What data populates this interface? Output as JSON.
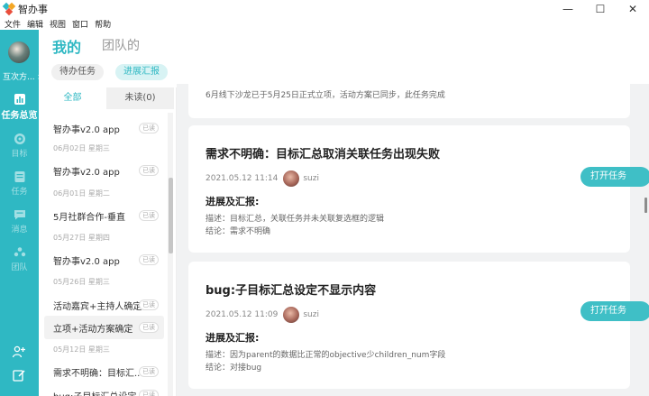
{
  "window": {
    "title": "智办事"
  },
  "window_controls": {
    "minimize": "—",
    "maximize": "☐",
    "close": "✕"
  },
  "menu": [
    "文件",
    "编辑",
    "视图",
    "窗口",
    "帮助"
  ],
  "rail": {
    "user_name": "互次方... >",
    "items": [
      {
        "label": "任务总览",
        "icon": "chart-icon",
        "active": true
      },
      {
        "label": "目标",
        "icon": "target-icon",
        "active": false
      },
      {
        "label": "任务",
        "icon": "task-icon",
        "active": false
      },
      {
        "label": "消息",
        "icon": "message-icon",
        "active": false
      },
      {
        "label": "团队",
        "icon": "team-icon",
        "active": false
      }
    ]
  },
  "top_tabs": {
    "mine": "我的",
    "team": "团队的"
  },
  "sub_tabs": {
    "todo": "待办任务",
    "report": "进展汇报"
  },
  "filter": {
    "all": "全部",
    "unread": "未读(0)"
  },
  "list": {
    "items": [
      {
        "title": "智办事v2.0 app",
        "badge": "已读",
        "date": "06月02日 星期三"
      },
      {
        "title": "智办事v2.0 app",
        "badge": "已读",
        "date": "06月01日 星期二"
      },
      {
        "title": "5月社群合作-垂直",
        "badge": "已读",
        "date": "05月27日 星期四"
      },
      {
        "title": "智办事v2.0 app",
        "badge": "已读",
        "date": "05月26日 星期三"
      },
      {
        "title": "活动嘉宾+主持人确定",
        "badge": "已读",
        "date": ""
      },
      {
        "title": "立项+活动方案确定",
        "badge": "已读",
        "date": "05月12日 星期三"
      },
      {
        "title": "需求不明确：目标汇...",
        "badge": "已读",
        "date": ""
      },
      {
        "title": "bug:子目标汇总设定...",
        "badge": "已读",
        "date": ""
      }
    ]
  },
  "cards": {
    "top": {
      "text": "6月线下沙龙已于5月25日正式立项，活动方案已同步，此任务完成"
    },
    "card1": {
      "title": "需求不明确：目标汇总取消关联任务出现失败",
      "time": "2021.05.12 11:14",
      "user": "suzi",
      "section": "进展及汇报:",
      "desc": "描述：目标汇总，关联任务并未关联复选框的逻辑",
      "conclusion": "结论：需求不明确",
      "button": "打开任务"
    },
    "card2": {
      "title": "bug:子目标汇总设定不显示内容",
      "time": "2021.05.12 11:09",
      "user": "suzi",
      "section": "进展及汇报:",
      "desc": "描述：因为parent的数据比正常的objective少children_num字段",
      "conclusion": "结论：对接bug",
      "button": "打开任务"
    }
  },
  "colors": {
    "accent": "#2fb8c3",
    "button": "#3fbfc6"
  }
}
